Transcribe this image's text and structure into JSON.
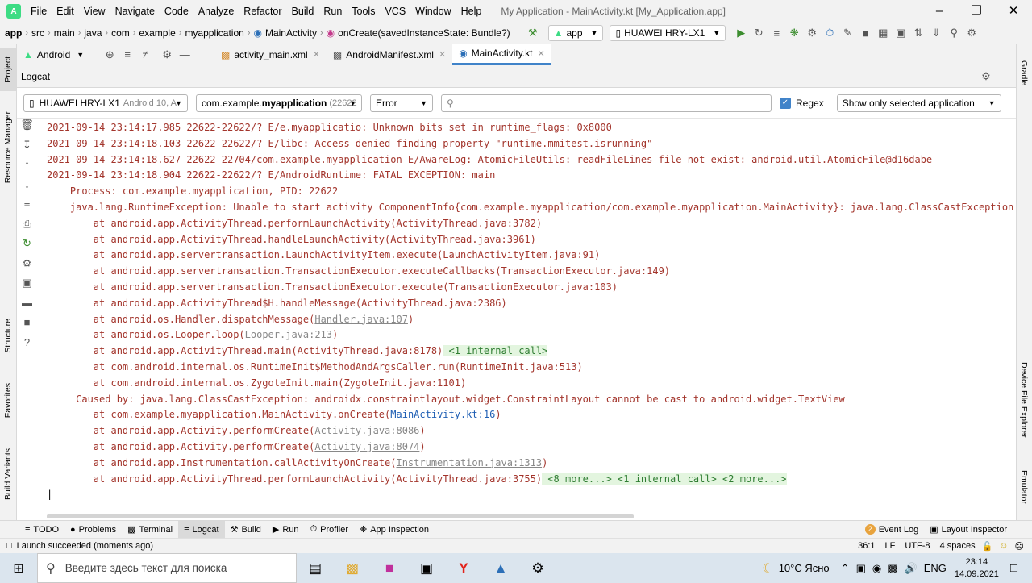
{
  "menubar": {
    "items": [
      "File",
      "Edit",
      "View",
      "Navigate",
      "Code",
      "Analyze",
      "Refactor",
      "Build",
      "Run",
      "Tools",
      "VCS",
      "Window",
      "Help"
    ],
    "title": "My Application - MainActivity.kt [My_Application.app]"
  },
  "navbar": {
    "crumbs": [
      "app",
      "src",
      "main",
      "java",
      "com",
      "example",
      "myapplication",
      "MainActivity",
      "onCreate(savedInstanceState: Bundle?)"
    ],
    "config": "app",
    "device": "HUAWEI HRY-LX1"
  },
  "project_panel": {
    "android_label": "Android"
  },
  "tabs": [
    {
      "label": "activity_main.xml"
    },
    {
      "label": "AndroidManifest.xml"
    },
    {
      "label": "MainActivity.kt"
    }
  ],
  "left_tools": {
    "project": "Project",
    "resource_manager": "Resource Manager",
    "structure": "Structure",
    "favorites": "Favorites",
    "build_variants": "Build Variants"
  },
  "right_tools": {
    "gradle": "Gradle",
    "device_file_explorer": "Device File Explorer",
    "emulator": "Emulator"
  },
  "logcat": {
    "title": "Logcat",
    "device": "HUAWEI HRY-LX1",
    "device_version": "Android 10, A",
    "process_prefix": "com.example.",
    "process_bold": "myapplication",
    "process_pid": "(22622",
    "level": "Error",
    "regex_label": "Regex",
    "regex_checked": true,
    "filter": "Show only selected application",
    "lines": {
      "l1": "2021-09-14 23:14:17.985 22622-22622/? E/e.myapplicatio: Unknown bits set in runtime_flags: 0x8000",
      "l2": "2021-09-14 23:14:18.103 22622-22622/? E/libc: Access denied finding property \"runtime.mmitest.isrunning\"",
      "l3": "2021-09-14 23:14:18.627 22622-22704/com.example.myapplication E/AwareLog: AtomicFileUtils: readFileLines file not exist: android.util.AtomicFile@d16dabe",
      "l4": "2021-09-14 23:14:18.904 22622-22622/? E/AndroidRuntime: FATAL EXCEPTION: main",
      "l5": "    Process: com.example.myapplication, PID: 22622",
      "l6": "    java.lang.RuntimeException: Unable to start activity ComponentInfo{com.example.myapplication/com.example.myapplication.MainActivity}: java.lang.ClassCastException: androidx.constraintlayout.widget.ConstraintLayout cannot be cast to android.widget.TextView",
      "l7": "        at android.app.ActivityThread.performLaunchActivity(ActivityThread.java:3782)",
      "l8": "        at android.app.ActivityThread.handleLaunchActivity(ActivityThread.java:3961)",
      "l9": "        at android.app.servertransaction.LaunchActivityItem.execute(LaunchActivityItem.java:91)",
      "l10": "        at android.app.servertransaction.TransactionExecutor.executeCallbacks(TransactionExecutor.java:149)",
      "l11": "        at android.app.servertransaction.TransactionExecutor.execute(TransactionExecutor.java:103)",
      "l12": "        at android.app.ActivityThread$H.handleMessage(ActivityThread.java:2386)",
      "l13a": "        at android.os.Handler.dispatchMessage(",
      "l13link": "Handler.java:107",
      "l14a": "        at android.os.Looper.loop(",
      "l14link": "Looper.java:213",
      "l15a": "        at android.app.ActivityThread.main(ActivityThread.java:8178)",
      "l15fold": " <1 internal call>",
      "l16": "        at com.android.internal.os.RuntimeInit$MethodAndArgsCaller.run(RuntimeInit.java:513)",
      "l17": "        at com.android.internal.os.ZygoteInit.main(ZygoteInit.java:1101)",
      "l18": "     Caused by: java.lang.ClassCastException: androidx.constraintlayout.widget.ConstraintLayout cannot be cast to android.widget.TextView",
      "l19a": "        at com.example.myapplication.MainActivity.onCreate(",
      "l19link": "MainActivity.kt:16",
      "l20a": "        at android.app.Activity.performCreate(",
      "l20link": "Activity.java:8086",
      "l21a": "        at android.app.Activity.performCreate(",
      "l21link": "Activity.java:8074",
      "l22a": "        at android.app.Instrumentation.callActivityOnCreate(",
      "l22link": "Instrumentation.java:1313",
      "l23a": "        at android.app.ActivityThread.performLaunchActivity(ActivityThread.java:3755)",
      "l23fold": " <8 more...> <1 internal call> <2 more...>"
    }
  },
  "bottom_tabs": [
    "TODO",
    "Problems",
    "Terminal",
    "Logcat",
    "Build",
    "Run",
    "Profiler",
    "App Inspection"
  ],
  "bottom_right": {
    "event_log_count": "2",
    "event_log": "Event Log",
    "layout_inspector": "Layout Inspector"
  },
  "status": {
    "message": "Launch succeeded (moments ago)",
    "position": "36:1",
    "line_sep": "LF",
    "encoding": "UTF-8",
    "indent": "4 spaces"
  },
  "taskbar": {
    "search_placeholder": "Введите здесь текст для поиска",
    "weather": "10°C  Ясно",
    "lang": "ENG",
    "time": "23:14",
    "date": "14.09.2021"
  }
}
